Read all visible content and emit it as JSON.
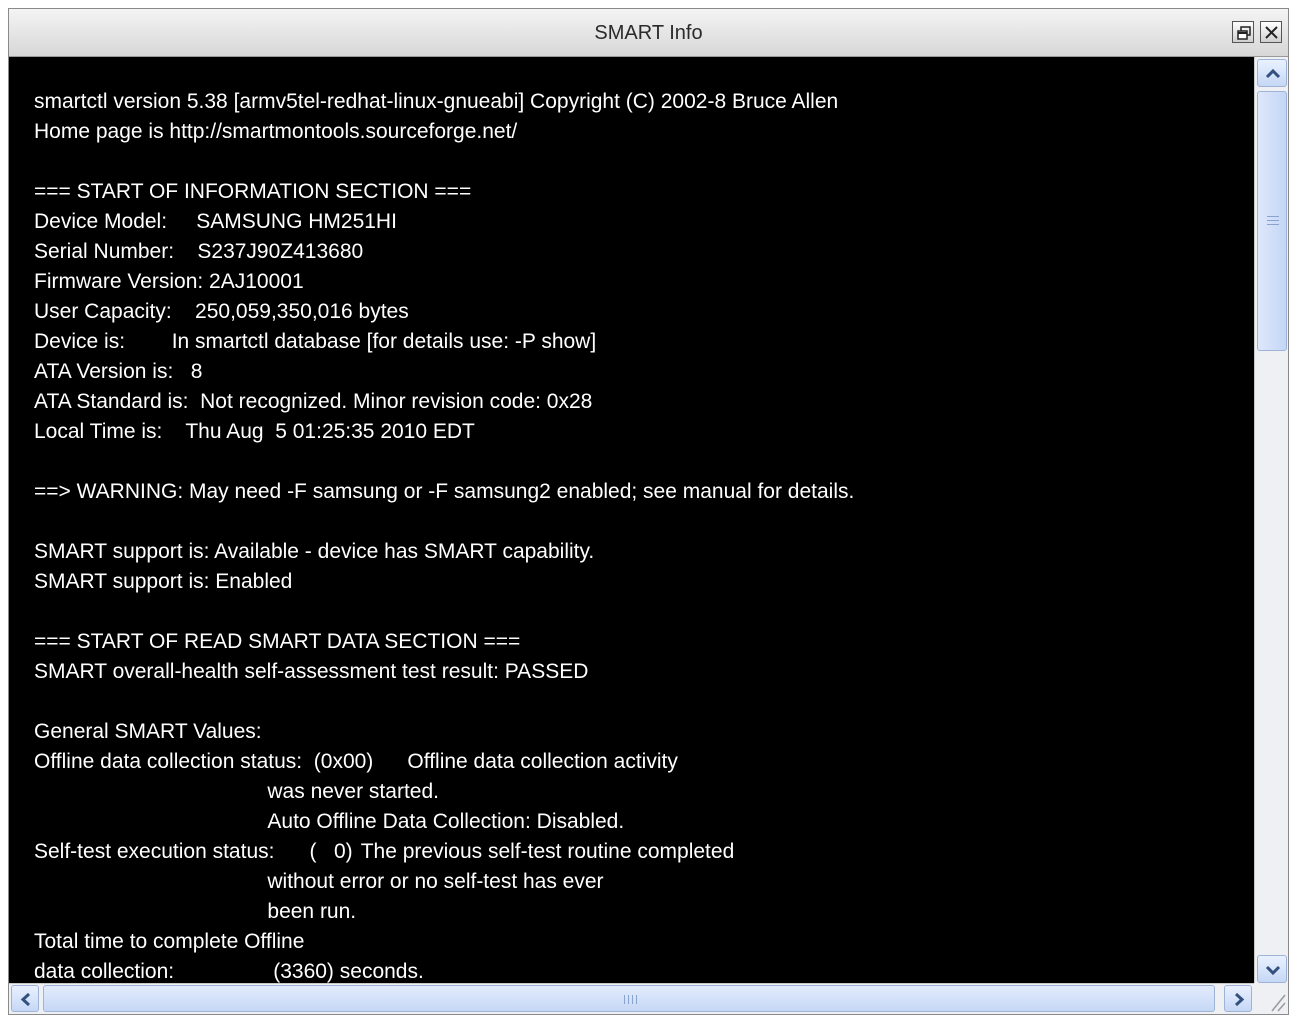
{
  "window": {
    "title": "SMART Info",
    "restore_icon": "restore-window-icon",
    "close_icon": "close-icon"
  },
  "terminal": {
    "text": "smartctl version 5.38 [armv5tel-redhat-linux-gnueabi] Copyright (C) 2002-8 Bruce Allen\nHome page is http://smartmontools.sourceforge.net/\n\n=== START OF INFORMATION SECTION ===\nDevice Model:     SAMSUNG HM251HI\nSerial Number:    S237J90Z413680\nFirmware Version: 2AJ10001\nUser Capacity:    250,059,350,016 bytes\nDevice is:        In smartctl database [for details use: -P show]\nATA Version is:   8\nATA Standard is:  Not recognized. Minor revision code: 0x28\nLocal Time is:    Thu Aug  5 01:25:35 2010 EDT\n\n==> WARNING: May need -F samsung or -F samsung2 enabled; see manual for details.\n\nSMART support is: Available - device has SMART capability.\nSMART support is: Enabled\n\n=== START OF READ SMART DATA SECTION ===\nSMART overall-health self-assessment test result: PASSED\n\nGeneral SMART Values:\nOffline data collection status:  (0x00)\tOffline data collection activity\n\t\t\t\t\twas never started.\n\t\t\t\t\tAuto Offline Data Collection: Disabled.\nSelf-test execution status:      (   0)\tThe previous self-test routine completed\n\t\t\t\t\twithout error or no self-test has ever \n\t\t\t\t\tbeen run.\nTotal time to complete Offline \ndata collection: \t\t (3360) seconds."
  },
  "scrollbars": {
    "up_icon": "chevron-up-icon",
    "down_icon": "chevron-down-icon",
    "left_icon": "chevron-left-icon",
    "right_icon": "chevron-right-icon",
    "vertical_position": 0.0,
    "horizontal_position": 0.0
  },
  "colors": {
    "terminal_background": "#000000",
    "terminal_text": "#ffffff",
    "scrollbar_accent": "#c6d8f6"
  }
}
